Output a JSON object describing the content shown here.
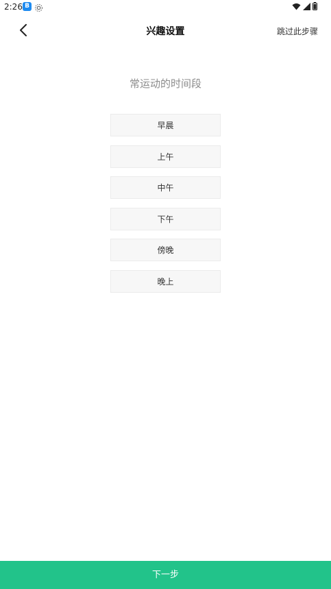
{
  "status_bar": {
    "time": "2:26",
    "app_icon_letter": "B"
  },
  "header": {
    "title": "兴趣设置",
    "skip_label": "跳过此步骤"
  },
  "section": {
    "title": "常运动的时间段"
  },
  "options": [
    {
      "label": "早晨"
    },
    {
      "label": "上午"
    },
    {
      "label": "中午"
    },
    {
      "label": "下午"
    },
    {
      "label": "傍晚"
    },
    {
      "label": "晚上"
    }
  ],
  "footer": {
    "next_label": "下一步"
  },
  "colors": {
    "accent": "#22c38a",
    "option_bg": "#f7f7f7",
    "subtitle": "#8c8c8c"
  }
}
